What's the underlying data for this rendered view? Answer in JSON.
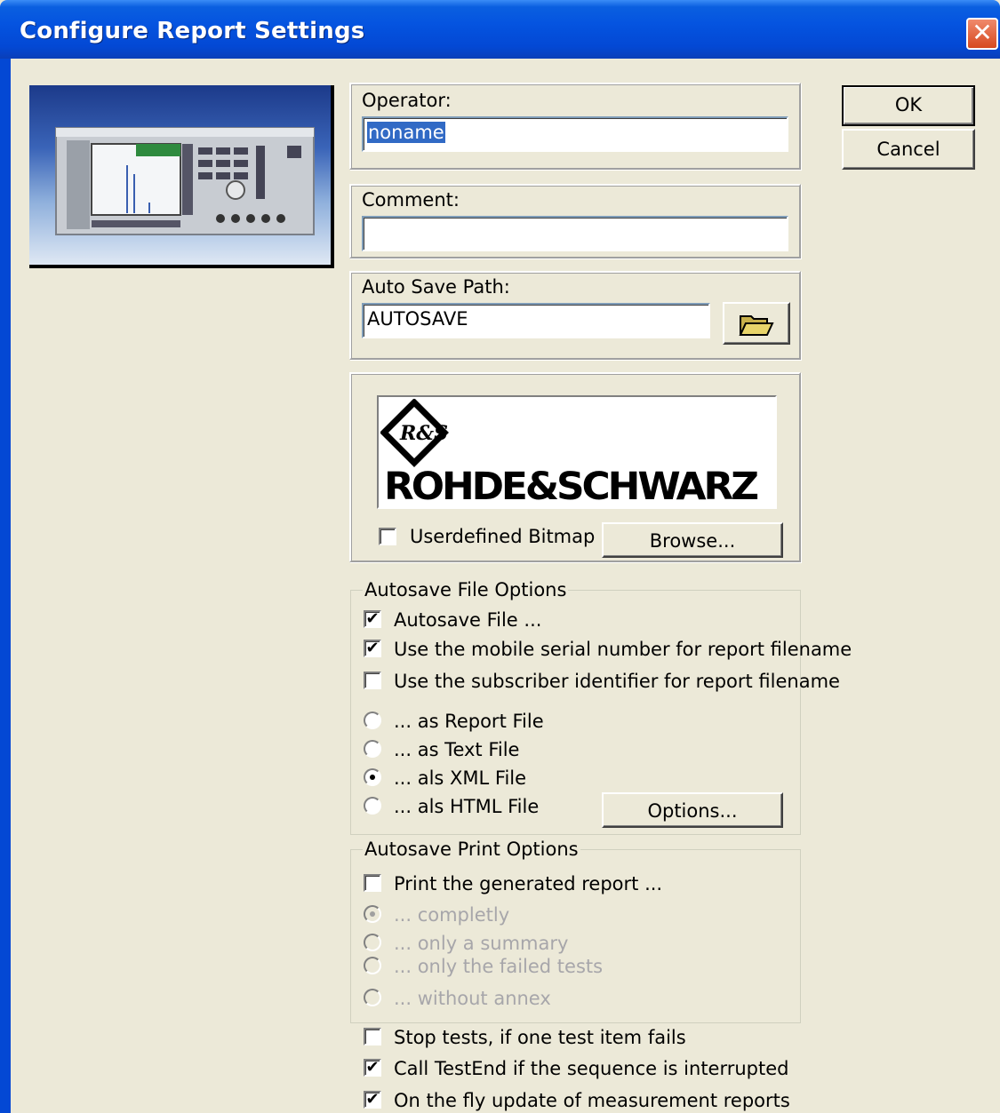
{
  "window": {
    "title": "Configure Report Settings",
    "close_icon": "close-icon"
  },
  "buttons": {
    "ok": "OK",
    "cancel": "Cancel",
    "browse": "Browse...",
    "options": "Options..."
  },
  "operator": {
    "label": "Operator:",
    "value": "noname"
  },
  "comment": {
    "label": "Comment:",
    "value": ""
  },
  "autosave_path": {
    "label": "Auto Save Path:",
    "value": "AUTOSAVE",
    "folder_icon": "folder-open-icon"
  },
  "logo": {
    "text": "ROHDE&SCHWARZ",
    "emblem": "R&S"
  },
  "userdefined_bitmap": {
    "label": "Userdefined Bitmap",
    "checked": false
  },
  "autosave_file_options": {
    "legend": "Autosave File Options",
    "checkboxes": [
      {
        "label": "Autosave File ...",
        "checked": true
      },
      {
        "label": "Use the mobile serial number for report filename",
        "checked": true
      },
      {
        "label": "Use the subscriber identifier for report filename",
        "checked": false
      }
    ],
    "radios": [
      {
        "label": "... as Report File",
        "selected": false
      },
      {
        "label": "... as Text File",
        "selected": false
      },
      {
        "label": "... als XML File",
        "selected": true
      },
      {
        "label": "... als HTML File",
        "selected": false
      }
    ]
  },
  "autosave_print_options": {
    "legend": "Autosave Print Options",
    "print_checkbox": {
      "label": "Print the generated report ...",
      "checked": false
    },
    "radios": [
      {
        "label": "... completly",
        "selected": true,
        "disabled": true
      },
      {
        "label": "... only a summary",
        "selected": false,
        "disabled": true
      },
      {
        "label": "... only the failed tests",
        "selected": false,
        "disabled": true
      },
      {
        "label": "... without annex",
        "selected": false,
        "disabled": true
      }
    ]
  },
  "bottom_options": [
    {
      "label": "Stop tests, if one test item fails",
      "checked": false
    },
    {
      "label": "Call TestEnd if the sequence is interrupted",
      "checked": true
    },
    {
      "label": "On the fly update of measurement reports",
      "checked": true
    }
  ]
}
